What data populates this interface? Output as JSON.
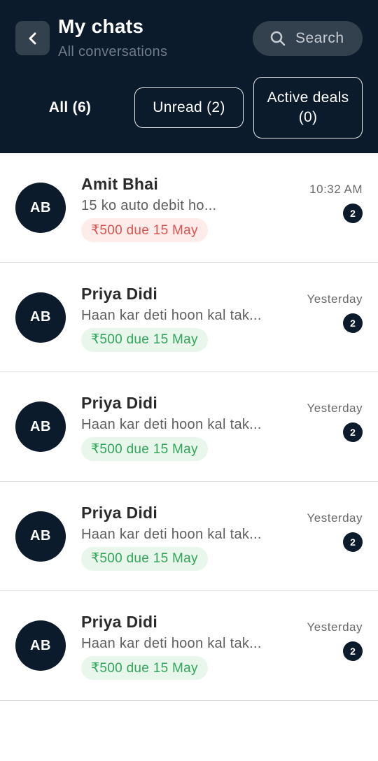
{
  "header": {
    "title": "My chats",
    "subtitle": "All conversations",
    "search_label": "Search"
  },
  "tabs": [
    {
      "label": "All (6)",
      "active": true
    },
    {
      "label": "Unread (2)",
      "active": false
    },
    {
      "label": "Active deals (0)",
      "active": false
    }
  ],
  "chats": [
    {
      "initials": "AB",
      "name": "Amit Bhai",
      "preview": "15 ko auto debit ho...",
      "due": "₹500 due 15 May",
      "due_status": "red",
      "time": "10:32 AM",
      "unread": "2"
    },
    {
      "initials": "AB",
      "name": "Priya Didi",
      "preview": "Haan kar deti hoon kal tak...",
      "due": "₹500 due 15 May",
      "due_status": "green",
      "time": "Yesterday",
      "unread": "2"
    },
    {
      "initials": "AB",
      "name": "Priya Didi",
      "preview": "Haan kar deti hoon kal tak...",
      "due": "₹500 due 15 May",
      "due_status": "green",
      "time": "Yesterday",
      "unread": "2"
    },
    {
      "initials": "AB",
      "name": "Priya Didi",
      "preview": "Haan kar deti hoon kal tak...",
      "due": "₹500 due 15 May",
      "due_status": "green",
      "time": "Yesterday",
      "unread": "2"
    },
    {
      "initials": "AB",
      "name": "Priya Didi",
      "preview": "Haan kar deti hoon kal tak...",
      "due": "₹500 due 15 May",
      "due_status": "green",
      "time": "Yesterday",
      "unread": "2"
    }
  ],
  "colors": {
    "header_bg": "#0b1b2c",
    "due_red": "#d9534f",
    "due_green": "#2fa65a"
  }
}
